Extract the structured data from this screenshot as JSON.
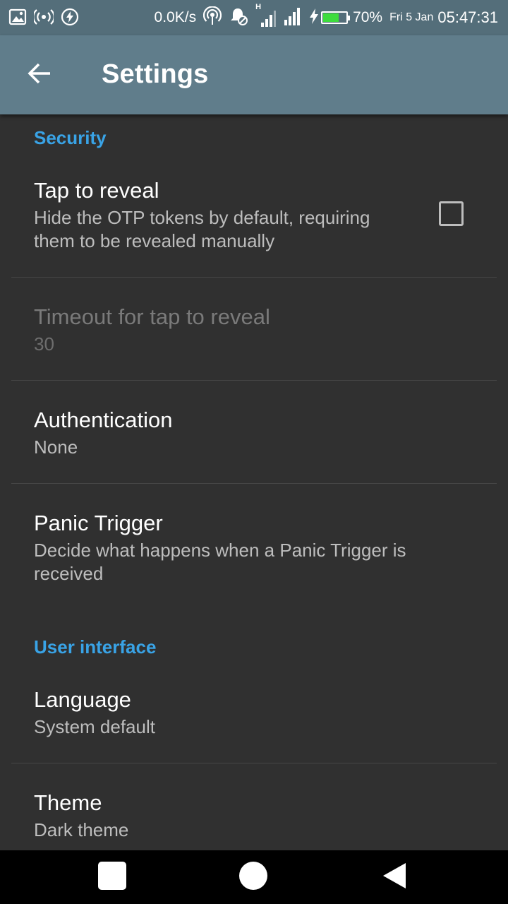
{
  "status_bar": {
    "network_speed": "0.0K/s",
    "network_type": "H",
    "battery_percent": "70%",
    "battery_level": 0.7,
    "date": "Fri 5 Jan",
    "time": "05:47:31"
  },
  "app_bar": {
    "title": "Settings",
    "back_icon": "arrow-back-icon"
  },
  "sections": {
    "security": {
      "header": "Security",
      "tap_to_reveal": {
        "title": "Tap to reveal",
        "summary": "Hide the OTP tokens by default, requiring them to be revealed manually",
        "checked": false
      },
      "timeout": {
        "title": "Timeout for tap to reveal",
        "value": "30",
        "enabled": false
      },
      "authentication": {
        "title": "Authentication",
        "value": "None"
      },
      "panic_trigger": {
        "title": "Panic Trigger",
        "summary": "Decide what happens when a Panic Trigger is received"
      }
    },
    "user_interface": {
      "header": "User interface",
      "language": {
        "title": "Language",
        "value": "System default"
      },
      "theme": {
        "title": "Theme",
        "value": "Dark theme"
      }
    }
  },
  "nav_bar": {
    "recents_icon": "square-recents-icon",
    "home_icon": "circle-home-icon",
    "back_icon": "triangle-back-icon"
  },
  "colors": {
    "status_bar": "#546e7a",
    "app_bar": "#607d8b",
    "background": "#303030",
    "accent": "#39a3e6",
    "battery_fill": "#3ddc3d"
  }
}
